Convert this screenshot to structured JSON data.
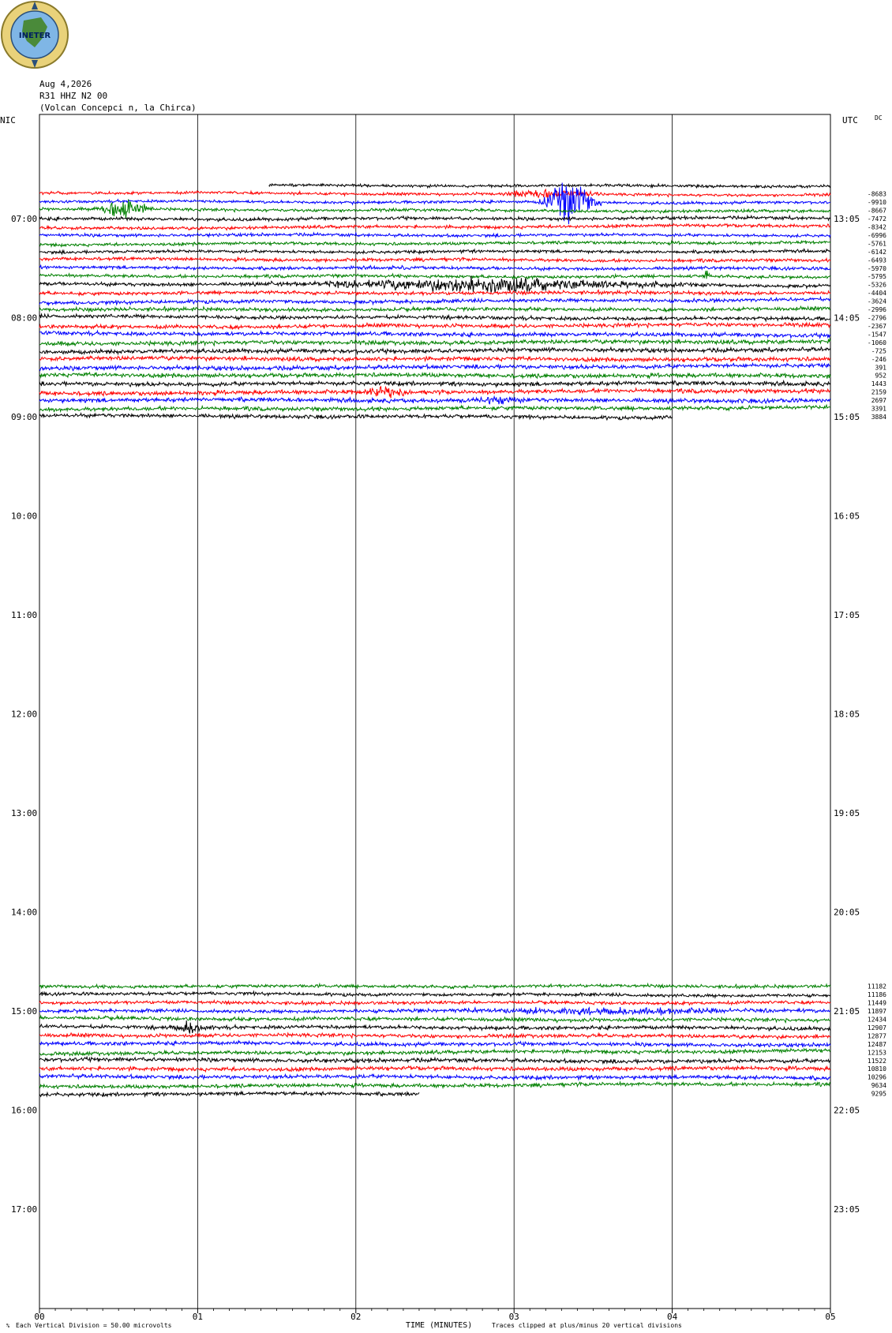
{
  "header": {
    "logo_text": "INETER",
    "date": "Aug 4,2026",
    "station": "R31 HHZ N2 00",
    "location": "(Volcan Concepci  n, la Chirca)",
    "left_axis_label": "NIC",
    "right_axis_label": "UTC",
    "dc_label": "DC"
  },
  "footer": {
    "division_note": "Each Vertical Division =    50.00 microvolts",
    "xlabel": "TIME (MINUTES)",
    "clip_note": "Traces clipped at plus/minus 20 vertical divisions"
  },
  "colors": {
    "trace_cycle": [
      "#000000",
      "#ff0000",
      "#0000ff",
      "#008000"
    ],
    "grid": "#000000"
  },
  "chart_data": {
    "type": "line",
    "title": "",
    "xlabel": "TIME (MINUTES)",
    "ylabel": "",
    "xlim": [
      0,
      5
    ],
    "x_ticks": [
      "00",
      "01",
      "02",
      "03",
      "04",
      "05"
    ],
    "left_hour_ticks": [
      "07:00",
      "08:00",
      "09:00",
      "10:00",
      "11:00",
      "12:00",
      "13:00",
      "14:00",
      "15:00",
      "16:00",
      "17:00"
    ],
    "right_hour_ticks": [
      "13:05",
      "14:05",
      "15:05",
      "16:05",
      "17:05",
      "18:05",
      "19:05",
      "20:05",
      "21:05",
      "22:05",
      "23:05"
    ],
    "rows_per_hour": 12,
    "first_row_hour": 6,
    "block1": {
      "start_row": 8,
      "rows": [
        {
          "start_min": 1.45,
          "amp": 1.2,
          "dc": ""
        },
        {
          "amp": 1.2,
          "dc": "-8683"
        },
        {
          "amp": 1.2,
          "dc": "-9910"
        },
        {
          "amp": 1.3,
          "dc": "-8667"
        },
        {
          "amp": 1.4,
          "dc": "-7472"
        },
        {
          "amp": 1.4,
          "dc": "-8342"
        },
        {
          "amp": 1.3,
          "dc": "-6996"
        },
        {
          "amp": 1.3,
          "dc": "-5761"
        },
        {
          "amp": 1.3,
          "dc": "-6142"
        },
        {
          "amp": 1.4,
          "dc": "-6493"
        },
        {
          "amp": 1.4,
          "dc": "-5970"
        },
        {
          "amp": 1.4,
          "dc": "-5795"
        },
        {
          "amp": 1.5,
          "dc": "-5326"
        },
        {
          "amp": 1.5,
          "dc": "-4404"
        },
        {
          "amp": 1.6,
          "dc": "-3624"
        },
        {
          "amp": 1.6,
          "dc": "-2996"
        },
        {
          "amp": 1.6,
          "dc": "-2796"
        },
        {
          "amp": 1.7,
          "dc": "-2367"
        },
        {
          "amp": 1.7,
          "dc": "-1547"
        },
        {
          "amp": 1.8,
          "dc": "-1060"
        },
        {
          "amp": 1.8,
          "dc": "-725"
        },
        {
          "amp": 1.8,
          "dc": "-246"
        },
        {
          "amp": 1.8,
          "dc": "391"
        },
        {
          "amp": 1.8,
          "dc": "952"
        },
        {
          "amp": 1.8,
          "dc": "1443"
        },
        {
          "amp": 1.8,
          "dc": "2159"
        },
        {
          "amp": 1.8,
          "dc": "2697"
        },
        {
          "amp": 1.7,
          "dc": "3391"
        },
        {
          "amp": 1.6,
          "dc": "3884",
          "end_min": 4.0
        }
      ]
    },
    "block2": {
      "start_row": 105,
      "color_offset": 3,
      "rows": [
        {
          "amp": 1.4,
          "dc": "11182"
        },
        {
          "amp": 1.4,
          "dc": "11186"
        },
        {
          "amp": 1.4,
          "dc": "11449"
        },
        {
          "amp": 1.5,
          "dc": "11897"
        },
        {
          "amp": 1.6,
          "dc": "12434"
        },
        {
          "amp": 1.6,
          "dc": "12907"
        },
        {
          "amp": 1.6,
          "dc": "12877"
        },
        {
          "amp": 1.6,
          "dc": "12487"
        },
        {
          "amp": 1.6,
          "dc": "12153"
        },
        {
          "amp": 1.7,
          "dc": "11522"
        },
        {
          "amp": 1.7,
          "dc": "10810"
        },
        {
          "amp": 1.7,
          "dc": "10296"
        },
        {
          "amp": 1.6,
          "dc": "9634"
        },
        {
          "amp": 1.6,
          "dc": "9295",
          "end_min": 2.4
        }
      ]
    },
    "events": [
      {
        "row": 11,
        "start_min": 0.35,
        "end_min": 0.72,
        "amp": 12
      },
      {
        "row": 10,
        "start_min": 3.15,
        "end_min": 3.55,
        "amp": 22
      },
      {
        "row": 9,
        "start_min": 2.85,
        "end_min": 3.6,
        "amp": 5
      },
      {
        "row": 20,
        "start_min": 1.4,
        "end_min": 4.3,
        "amp": 7
      },
      {
        "row": 18,
        "start_min": 2.28,
        "end_min": 2.32,
        "amp": 10
      },
      {
        "row": 19,
        "start_min": 4.2,
        "end_min": 4.24,
        "amp": 10
      },
      {
        "row": 33,
        "start_min": 2.0,
        "end_min": 2.35,
        "amp": 6
      },
      {
        "row": 34,
        "start_min": 2.7,
        "end_min": 3.1,
        "amp": 4
      },
      {
        "row": 108,
        "start_min": 2.2,
        "end_min": 5.0,
        "amp": 3
      },
      {
        "row": 110,
        "start_min": 0.8,
        "end_min": 1.1,
        "amp": 6
      }
    ]
  }
}
